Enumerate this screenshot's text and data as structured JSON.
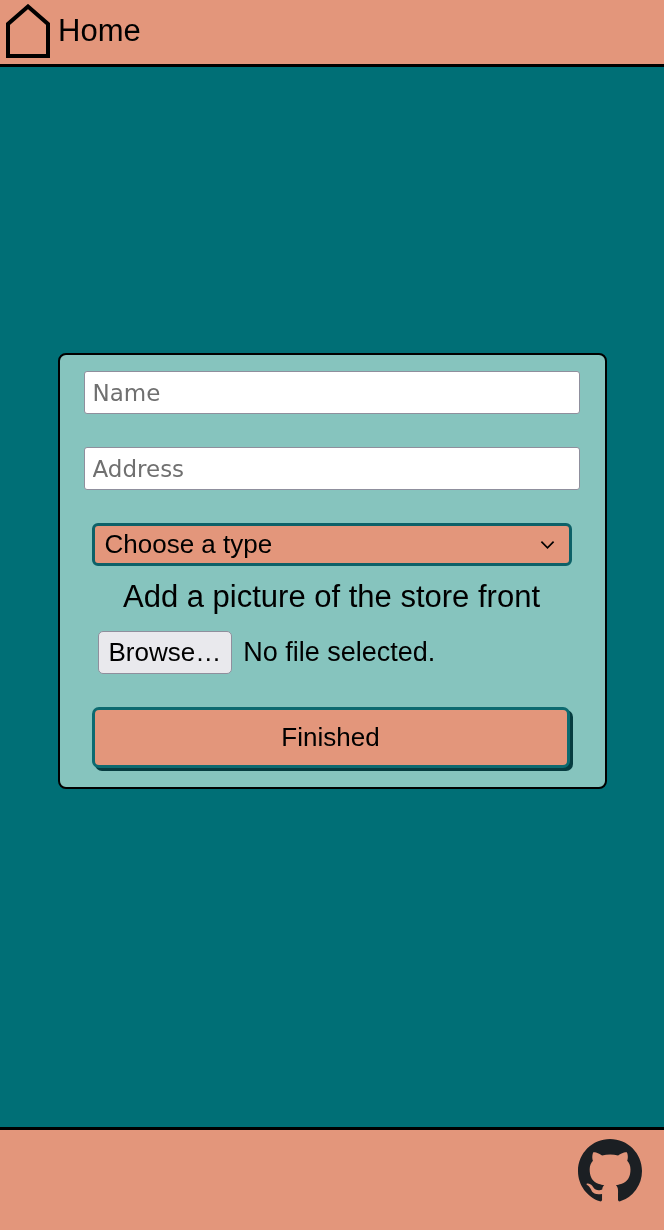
{
  "header": {
    "title": "Home"
  },
  "form": {
    "fields": [
      {
        "placeholder": "Name"
      },
      {
        "placeholder": "Address"
      }
    ],
    "type_select": {
      "value": "Choose a type"
    },
    "picture_prompt": "Add a picture of the store front",
    "file_input": {
      "button": "Browse…",
      "status": "No file selected."
    },
    "submit_button": "Finished"
  }
}
